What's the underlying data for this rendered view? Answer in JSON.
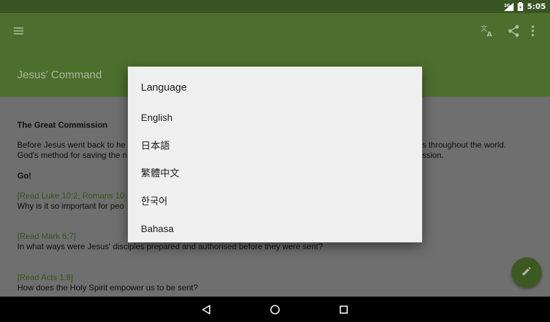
{
  "status_bar": {
    "time": "5:05",
    "network": "3G",
    "icons": [
      "signal-icon",
      "battery-icon"
    ]
  },
  "app_bar": {
    "title": "Jesus' Command",
    "icons": [
      "menu-icon",
      "translate-icon",
      "share-icon",
      "more-vert-icon"
    ]
  },
  "content": {
    "section_heading": "The Great Commission",
    "para_line1_start": "Before Jesus went back to he",
    "para_line1_end": "s throughout the world.",
    "para_line2_start": "God's method for saving the n",
    "para_line2_end": "ssion.",
    "go_heading": "Go!",
    "ref1": "[Read Luke 10:2, Romans 10:",
    "question1": "Why is it so important for peo",
    "ref2": "[Read Mark 6:7]",
    "question2": "In what ways were Jesus' disciples prepared and authorised before they were sent?",
    "ref3": "[Read Acts 1:8]",
    "question3": "How does the Holy Spirit empower us to be sent?"
  },
  "fab": {
    "icon": "edit-icon"
  },
  "dialog": {
    "title": "Language",
    "options": [
      "English",
      "日本語",
      "繁體中文",
      "한국어",
      "Bahasa"
    ]
  },
  "nav_bar": {
    "icons": [
      "back-icon",
      "home-icon",
      "recents-icon"
    ]
  },
  "colors": {
    "status_bar": "#3a5524",
    "app_bar": "#4c6f2e",
    "scrim_content": "#6f6f6f",
    "dialog_bg": "#efefef",
    "reference_text": "#36521c"
  }
}
